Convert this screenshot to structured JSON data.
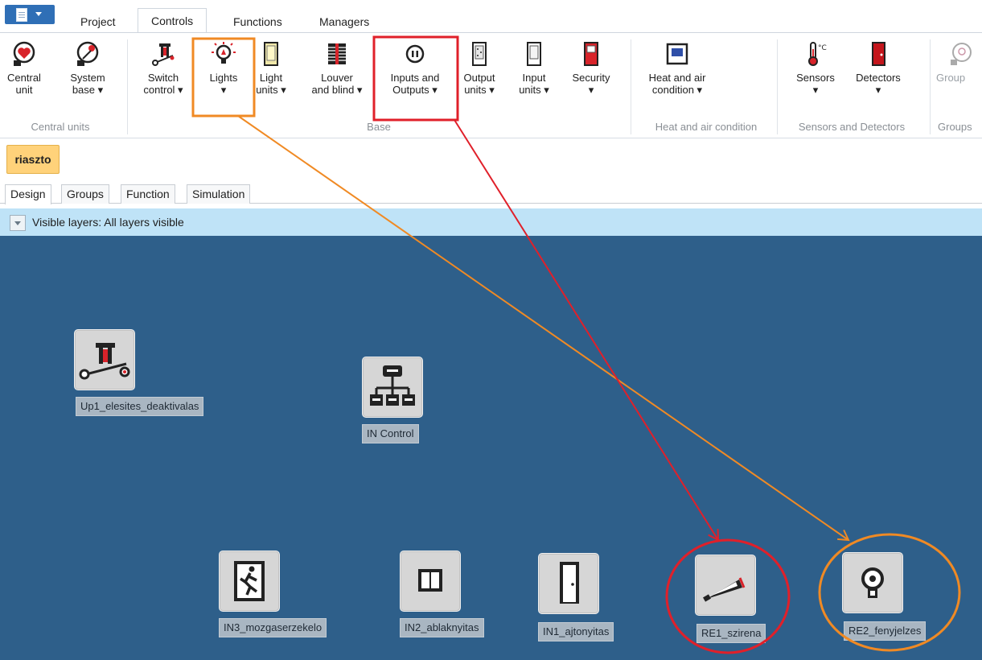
{
  "menu": {
    "tabs": [
      "Project",
      "Controls",
      "Functions",
      "Managers"
    ],
    "active": "Controls"
  },
  "ribbon": {
    "buttons": {
      "central_unit": "Central\nunit",
      "system_base": "System\nbase ▾",
      "switch_control": "Switch\ncontrol ▾",
      "lights": "Lights\n▾",
      "light_units": "Light\nunits ▾",
      "louver": "Louver\nand blind ▾",
      "inputs_outputs": "Inputs and\nOutputs ▾",
      "output_units": "Output\nunits ▾",
      "input_units": "Input\nunits ▾",
      "security": "Security\n▾",
      "heat_air": "Heat and air\ncondition ▾",
      "sensors": "Sensors\n▾",
      "detectors": "Detectors\n▾",
      "groups": "Group"
    },
    "group_labels": {
      "central_units": "Central units",
      "base": "Base",
      "heat_air": "Heat and air condition",
      "sensors_detectors": "Sensors and Detectors",
      "groups": "Groups"
    }
  },
  "document_tab": "riaszto",
  "view_tabs": [
    "Design",
    "Groups",
    "Function",
    "Simulation"
  ],
  "layers": {
    "text": "Visible layers: All layers visible"
  },
  "canvas": {
    "nodes": {
      "up1": "Up1_elesites_deaktivalas",
      "incontrol": "IN Control",
      "in3": "IN3_mozgaserzekelo",
      "in2": "IN2_ablaknyitas",
      "in1": "IN1_ajtonyitas",
      "re1": "RE1_szirena",
      "re2": "RE2_fenyjelzes"
    }
  },
  "colors": {
    "canvas": "#2e5f8a",
    "annotation_orange": "#f08a24",
    "annotation_red": "#e0202a",
    "accent_blue": "#2f6fb6"
  }
}
